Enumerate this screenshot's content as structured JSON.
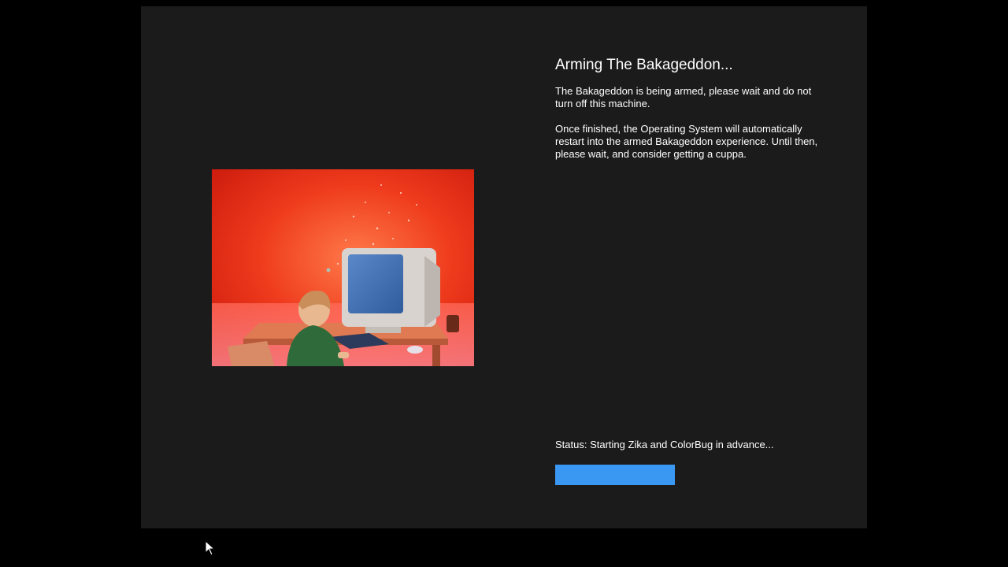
{
  "setup": {
    "title": "Arming The Bakageddon...",
    "paragraph_1": "The Bakageddon is being armed, please wait and do not turn off this machine.",
    "paragraph_2": "Once finished, the Operating System will automatically restart into the armed Bakageddon experience. Until then, please wait, and consider getting a cuppa.",
    "status_label": "Status:",
    "status_text": "Starting Zika and ColorBug in advance...",
    "progress_fraction": 1.0
  },
  "illustration": {
    "icon": "child-at-crt-computer-illustration"
  },
  "colors": {
    "background": "#000000",
    "panel": "#1b1b1b",
    "accent": "#3a97f2",
    "text": "#ffffff",
    "illustration_red": "#e83a1f"
  }
}
